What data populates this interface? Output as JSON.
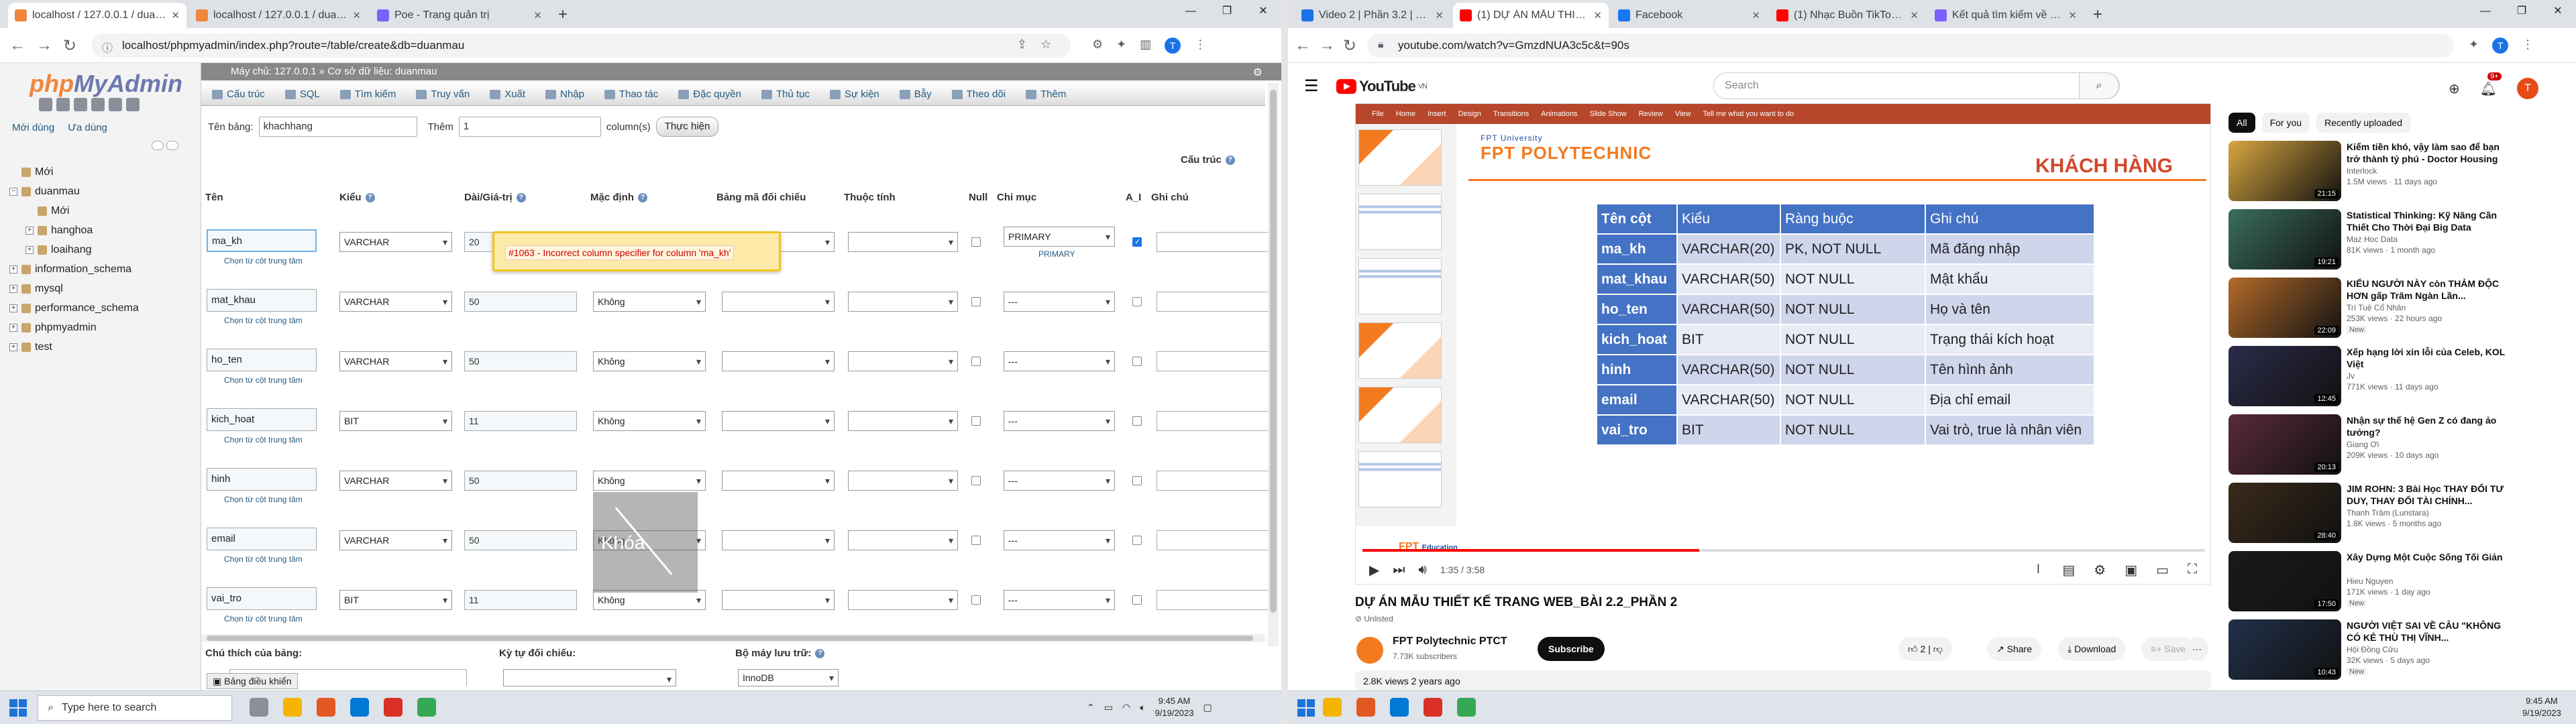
{
  "left_browser": {
    "tabs": [
      {
        "title": "localhost / 127.0.0.1 / duanmau",
        "color": "#f0863b"
      },
      {
        "title": "localhost / 127.0.0.1 / duanmau",
        "color": "#f0863b"
      },
      {
        "title": "Poe - Trang quản trị",
        "color": "#7b61ff"
      }
    ],
    "new_tab": "+",
    "address": "localhost/phpmyadmin/index.php?route=/table/create&db=duanmau",
    "window_controls": [
      "—",
      "❐",
      "✕"
    ]
  },
  "phpmyadmin": {
    "logo_php": "php",
    "logo_my_admin": "MyAdmin",
    "nav_tabs": [
      "Mới dùng",
      "Ưa dùng"
    ],
    "tree": [
      {
        "label": "Mới",
        "level": 0,
        "expander": ""
      },
      {
        "label": "duanmau",
        "level": 0,
        "expander": "−"
      },
      {
        "label": "Mới",
        "level": 1,
        "expander": ""
      },
      {
        "label": "hanghoa",
        "level": 1,
        "expander": "+"
      },
      {
        "label": "loaihang",
        "level": 1,
        "expander": "+"
      },
      {
        "label": "information_schema",
        "level": 0,
        "expander": "+"
      },
      {
        "label": "mysql",
        "level": 0,
        "expander": "+"
      },
      {
        "label": "performance_schema",
        "level": 0,
        "expander": "+"
      },
      {
        "label": "phpmyadmin",
        "level": 0,
        "expander": "+"
      },
      {
        "label": "test",
        "level": 0,
        "expander": "+"
      }
    ],
    "breadcrumb_server": "Máy chủ: 127.0.0.1",
    "breadcrumb_db": "Cơ sở dữ liệu: duanmau",
    "menu": [
      "Cấu trúc",
      "SQL",
      "Tìm kiếm",
      "Truy vấn",
      "Xuất",
      "Nhập",
      "Thao tác",
      "Đặc quyền",
      "Thủ tục",
      "Sự kiện",
      "Bẫy",
      "Theo dõi",
      "Thêm"
    ],
    "table_name_label": "Tên bảng:",
    "table_name_value": "khachhang",
    "add_label": "Thêm",
    "add_value": "1",
    "columns_label": "column(s)",
    "run_button": "Thực hiện",
    "structure_label": "Cấu trúc",
    "headers": {
      "name": "Tên",
      "type": "Kiểu",
      "length": "Dài/Giá-trị",
      "default": "Mặc định",
      "collation": "Bảng mã đối chiếu",
      "attributes": "Thuộc tính",
      "null": "Null",
      "index": "Chỉ mục",
      "ai": "A_I",
      "comments": "Ghi chú"
    },
    "pick_central": "Chọn từ cột trung tâm",
    "fields": [
      {
        "name": "ma_kh",
        "type": "VARCHAR",
        "length": "20",
        "default": "",
        "index": "PRIMARY",
        "index_sub": "PRIMARY",
        "ai": true
      },
      {
        "name": "mat_khau",
        "type": "VARCHAR",
        "length": "50",
        "default": "Không",
        "index": "---",
        "index_sub": "",
        "ai": false
      },
      {
        "name": "ho_ten",
        "type": "VARCHAR",
        "length": "50",
        "default": "Không",
        "index": "---",
        "index_sub": "",
        "ai": false
      },
      {
        "name": "kich_hoat",
        "type": "BIT",
        "length": "11",
        "default": "Không",
        "index": "---",
        "index_sub": "",
        "ai": false
      },
      {
        "name": "hinh",
        "type": "VARCHAR",
        "length": "50",
        "default": "Không",
        "index": "---",
        "index_sub": "",
        "ai": false
      },
      {
        "name": "email",
        "type": "VARCHAR",
        "length": "50",
        "default": "Không",
        "index": "---",
        "index_sub": "",
        "ai": false
      },
      {
        "name": "vai_tro",
        "type": "BIT",
        "length": "11",
        "default": "Không",
        "index": "---",
        "index_sub": "",
        "ai": false
      }
    ],
    "error_message": "#1063 - Incorrect column specifier for column 'ma_kh'",
    "overlay_text": "Khóa",
    "table_comment_label": "Chú thích của bảng:",
    "collation_label": "Kỳ tự đối chiếu:",
    "engine_label": "Bộ máy lưu trữ:",
    "engine_value": "InnoDB",
    "console_tab": "Bảng điều khiển"
  },
  "right_browser": {
    "tabs": [
      {
        "title": "Video 2 | Phần 3.2 | WEB2041 Củ",
        "color": "#1a73e8"
      },
      {
        "title": "(1) DỰ ÁN MẪU THIẾT KẾ TRANG",
        "color": "#ff0000"
      },
      {
        "title": "Facebook",
        "color": "#1877f2"
      },
      {
        "title": "(1) Nhạc Buồn TikTok 2023",
        "color": "#ff0000"
      },
      {
        "title": "Kết quả tìm kiếm về youtube trê",
        "color": "#7b61ff"
      }
    ],
    "address": "youtube.com/watch?v=GmzdNUA3c5c&t=90s"
  },
  "youtube": {
    "logo": "YouTube",
    "logo_region": "VN",
    "search_placeholder": "Search",
    "notif_count": "9+",
    "avatar_letter": "T",
    "ribbon_tabs": [
      "File",
      "Home",
      "Insert",
      "Design",
      "Transitions",
      "Animations",
      "Slide Show",
      "Review",
      "View",
      "Tell me what you want to do"
    ],
    "slide": {
      "brand": "FPT POLYTECHNIC",
      "brand_sub": "FPT University",
      "title": "KHÁCH HÀNG",
      "headers": [
        "Tên cột",
        "Kiểu",
        "Ràng buộc",
        "Ghi chú"
      ],
      "rows": [
        [
          "ma_kh",
          "VARCHAR(20)",
          "PK, NOT NULL",
          "Mã đăng nhập"
        ],
        [
          "mat_khau",
          "VARCHAR(50)",
          "NOT NULL",
          "Mật khẩu"
        ],
        [
          "ho_ten",
          "VARCHAR(50)",
          "NOT NULL",
          "Họ và tên"
        ],
        [
          "kich_hoat",
          "BIT",
          "NOT NULL",
          "Trạng thái kích hoạt"
        ],
        [
          "hinh",
          "VARCHAR(50)",
          "NOT NULL",
          "Tên hình ảnh"
        ],
        [
          "email",
          "VARCHAR(50)",
          "NOT NULL",
          "Địa chỉ email"
        ],
        [
          "vai_tro",
          "BIT",
          "NOT NULL",
          "Vai trò, true là nhân viên"
        ]
      ],
      "footer_brand": "FPT",
      "footer_sub": "Education"
    },
    "progress_fraction": 0.4,
    "time": "1:35 / 3:58",
    "video_title": "DỰ ÁN MẪU THIẾT KẾ TRANG WEB_BÀI 2.2_PHẦN 2",
    "unlisted": "Unlisted",
    "channel": "FPT Polytechnic PTCT",
    "subscribers": "7.73K subscribers",
    "subscribe": "Subscribe",
    "likes": "2",
    "share": "Share",
    "download": "Download",
    "save": "Save",
    "more": "···",
    "views_date": "2.8K views  2 years ago",
    "chips": [
      "All",
      "For you",
      "Recently uploaded"
    ],
    "recommendations": [
      {
        "title": "Kiểm tiền khó, vậy làm sao để bạn trở thành tỷ phú - Doctor Housing",
        "channel": "Interlock",
        "meta": "1.5M views · 11 days ago",
        "new": "",
        "duration": "21:15",
        "color": "#d8a640"
      },
      {
        "title": "Statistical Thinking: Kỹ Năng Cần Thiết Cho Thời Đại Big Data",
        "channel": "Maz Hoc Data",
        "meta": "81K views · 1 month ago",
        "new": "",
        "duration": "19:21",
        "color": "#3a6e5c"
      },
      {
        "title": "KIỂU NGƯỜI NÀY còn THẢM ĐỘC HƠN gấp Trăm Ngàn Lần...",
        "channel": "Trí Tuệ Cổ Nhân",
        "meta": "253K views · 22 hours ago",
        "new": "New",
        "duration": "22:09",
        "color": "#b36b2a"
      },
      {
        "title": "Xếp hạng lời xin lỗi của Celeb, KOL Việt",
        "channel": "Jv",
        "meta": "771K views · 11 days ago",
        "new": "",
        "duration": "12:45",
        "color": "#2b2b4a"
      },
      {
        "title": "Nhận sự thể hệ Gen Z có đang ảo tưởng?",
        "channel": "Giang Ơi",
        "meta": "209K views · 10 days ago",
        "new": "",
        "duration": "20:13",
        "color": "#5a2a3a"
      },
      {
        "title": "JIM ROHN: 3 Bài Học THAY ĐỔI TƯ DUY, THAY ĐỔI TÀI CHÍNH...",
        "channel": "Thanh Trâm (Lunstara)",
        "meta": "1.8K views · 5 months ago",
        "new": "",
        "duration": "28:40",
        "color": "#3a2a1a"
      },
      {
        "title": "Xây Dựng Một Cuộc Sống Tối Giản",
        "channel": "Hieu Nguyen",
        "meta": "171K views · 1 day ago",
        "new": "New",
        "duration": "17:50",
        "color": "#1a1a1a"
      },
      {
        "title": "NGƯỜI VIỆT SAI VỀ CÂU \"KHÔNG CÓ KẺ THÙ THỊ VĨNH...",
        "channel": "Hội Đồng Cửu",
        "meta": "32K views · 5 days ago",
        "new": "New",
        "duration": "10:43",
        "color": "#20304a"
      }
    ]
  },
  "taskbar_left": {
    "search_placeholder": "Type here to search",
    "time": "9:45 AM",
    "date": "9/19/2023",
    "app_colors": [
      "#8a8f9a",
      "#f4b400",
      "#e25822",
      "#0078d4",
      "#d93025",
      "#34a853"
    ]
  },
  "taskbar_right": {
    "time": "9:45 AM",
    "date": "9/19/2023",
    "app_colors": [
      "#f4b400",
      "#e25822",
      "#0078d4",
      "#d93025",
      "#34a853"
    ]
  }
}
